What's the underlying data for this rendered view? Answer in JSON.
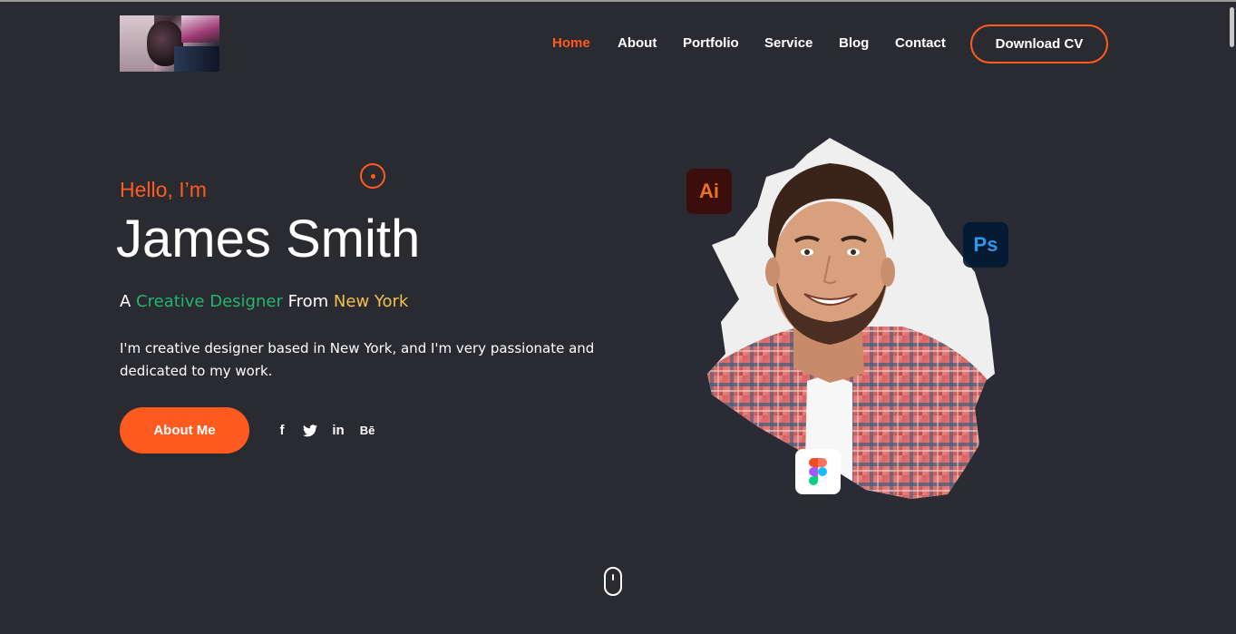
{
  "header": {
    "logo": "avatar-photo",
    "nav": [
      {
        "label": "Home",
        "active": true
      },
      {
        "label": "About",
        "active": false
      },
      {
        "label": "Portfolio",
        "active": false
      },
      {
        "label": "Service",
        "active": false
      },
      {
        "label": "Blog",
        "active": false
      },
      {
        "label": "Contact",
        "active": false
      }
    ],
    "cta_label": "Download CV"
  },
  "hero": {
    "greeting": "Hello, I’m",
    "name": "James Smith",
    "tagline": {
      "prefix": "A ",
      "role": "Creative Designer",
      "middle": " From ",
      "city": "New York"
    },
    "description": "I'm creative designer based in New York, and I'm very passionate and dedicated to my work.",
    "button_label": "About Me",
    "social": [
      {
        "icon": "facebook-icon",
        "glyph": "f"
      },
      {
        "icon": "twitter-icon",
        "glyph": "🐦"
      },
      {
        "icon": "linkedin-icon",
        "glyph": "in"
      },
      {
        "icon": "behance-icon",
        "glyph": "Bē"
      }
    ],
    "badges": {
      "ai": "Ai",
      "ps": "Ps",
      "figma": "figma-icon"
    }
  },
  "colors": {
    "background": "#2a2b31",
    "accent": "#ff5a1f",
    "green": "#22b573",
    "gold": "#f2c14e"
  }
}
